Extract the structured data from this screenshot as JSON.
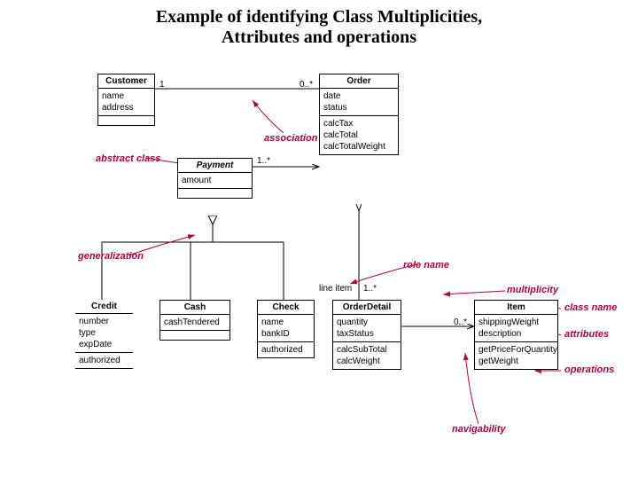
{
  "title_line1": "Example of identifying Class Multiplicities,",
  "title_line2": "Attributes and operations",
  "classes": {
    "customer": {
      "name": "Customer",
      "attrs": [
        "name",
        "address"
      ],
      "ops": []
    },
    "order": {
      "name": "Order",
      "attrs": [
        "date",
        "status"
      ],
      "ops": [
        "calcTax",
        "calcTotal",
        "calcTotalWeight"
      ]
    },
    "payment": {
      "name": "Payment",
      "attrs": [
        "amount"
      ],
      "ops": []
    },
    "credit": {
      "name": "Credit",
      "attrs": [
        "number",
        "type",
        "expDate"
      ],
      "ops": [
        "authorized"
      ]
    },
    "cash": {
      "name": "Cash",
      "attrs": [
        "cashTendered"
      ],
      "ops": []
    },
    "check": {
      "name": "Check",
      "attrs": [
        "name",
        "bankID"
      ],
      "ops": [
        "authorized"
      ]
    },
    "orderdetail": {
      "name": "OrderDetail",
      "attrs": [
        "quantity",
        "taxStatus"
      ],
      "ops": [
        "calcSubTotal",
        "calcWeight"
      ]
    },
    "item": {
      "name": "Item",
      "attrs": [
        "shippingWeight",
        "description"
      ],
      "ops": [
        "getPriceForQuantity",
        "getWeight"
      ]
    }
  },
  "multiplicities": {
    "cust_order_left": "1",
    "cust_order_right": "0..*",
    "order_payment": "1..*",
    "order_detail": "1..*",
    "detail_item": "0..*",
    "line_item": "line item"
  },
  "annotations": {
    "abstract_class": "abstract class",
    "association": "association",
    "generalization": "generalization",
    "role_name": "role name",
    "multiplicity": "multiplicity",
    "class_name": "class name",
    "attributes": "attributes",
    "operations": "operations",
    "navigability": "navigability"
  }
}
